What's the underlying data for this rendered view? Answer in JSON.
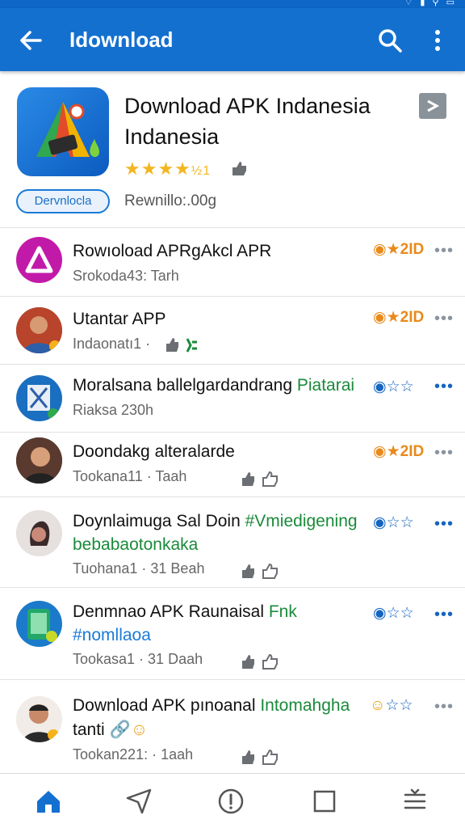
{
  "app_bar": {
    "title": "Idownload"
  },
  "hero": {
    "title": "Download APK Indanesia Indanesia",
    "rating_stars": "★★★★",
    "rating_partial": "½1",
    "pill_label": "Dervnlocla",
    "subtitle": "Rewnillo:.00g"
  },
  "items": [
    {
      "title": "Rowıoload APRgAkcl APR",
      "title_green": "",
      "subtitle": "Srokoda43:  Tarh",
      "badge": "2ID",
      "badge_color": "#e88a1a"
    },
    {
      "title": "Utantar APP",
      "title_green": "",
      "subtitle": "Indaonatı1  ·",
      "badge": "2ID",
      "badge_color": "#e88a1a"
    },
    {
      "title": "Moralsana ballelgardandrang",
      "title_green": " Piatarai",
      "subtitle": "Riaksa 230h",
      "badge": "",
      "badge_color": "#1565c0"
    },
    {
      "title": "Doondakg alteralarde",
      "title_green": "",
      "subtitle": "Tookana11 ·  Taah",
      "badge": "2ID",
      "badge_color": "#e88a1a"
    },
    {
      "title": "Doynlaimuga Sal Doin",
      "title_green": " #Vmiedigening",
      "title2": "bebabaotonkaka",
      "subtitle": "Tuohana1 · 31 Beah",
      "badge": "",
      "badge_color": "#1565c0"
    },
    {
      "title": "Denmnao APK Raunaisal",
      "title_green": " Fnk",
      "title2": "#nomllaoa",
      "subtitle": "Tookasa1 · 31 Daah",
      "badge": "",
      "badge_color": "#1565c0"
    },
    {
      "title": "Download APK pınoanal",
      "title_green": " Intomahgha",
      "title3": "tanti",
      "subtitle": "Tookan221:  ·  1aah",
      "badge": "",
      "badge_color": "#1565c0"
    }
  ],
  "bottom_nav": [
    "home-icon",
    "send-icon",
    "info-icon",
    "square-icon",
    "menu-icon"
  ],
  "colors": {
    "primary": "#1470cf",
    "accent_orange": "#e88a1a",
    "accent_green": "#1a8a3a",
    "star": "#f3b61f"
  }
}
